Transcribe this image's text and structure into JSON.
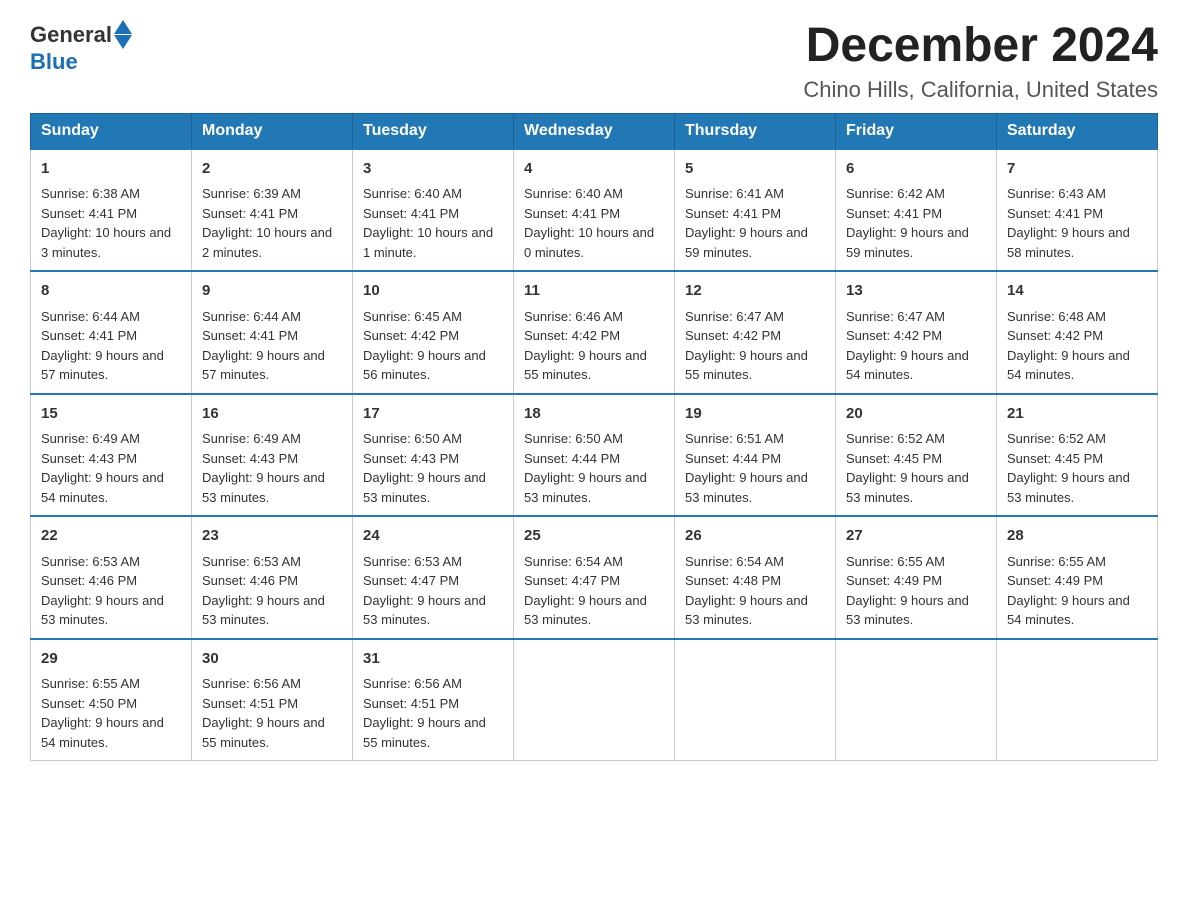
{
  "logo": {
    "general": "General",
    "blue": "Blue"
  },
  "title": "December 2024",
  "location": "Chino Hills, California, United States",
  "days_of_week": [
    "Sunday",
    "Monday",
    "Tuesday",
    "Wednesday",
    "Thursday",
    "Friday",
    "Saturday"
  ],
  "weeks": [
    [
      {
        "day": "1",
        "sunrise": "Sunrise: 6:38 AM",
        "sunset": "Sunset: 4:41 PM",
        "daylight": "Daylight: 10 hours and 3 minutes."
      },
      {
        "day": "2",
        "sunrise": "Sunrise: 6:39 AM",
        "sunset": "Sunset: 4:41 PM",
        "daylight": "Daylight: 10 hours and 2 minutes."
      },
      {
        "day": "3",
        "sunrise": "Sunrise: 6:40 AM",
        "sunset": "Sunset: 4:41 PM",
        "daylight": "Daylight: 10 hours and 1 minute."
      },
      {
        "day": "4",
        "sunrise": "Sunrise: 6:40 AM",
        "sunset": "Sunset: 4:41 PM",
        "daylight": "Daylight: 10 hours and 0 minutes."
      },
      {
        "day": "5",
        "sunrise": "Sunrise: 6:41 AM",
        "sunset": "Sunset: 4:41 PM",
        "daylight": "Daylight: 9 hours and 59 minutes."
      },
      {
        "day": "6",
        "sunrise": "Sunrise: 6:42 AM",
        "sunset": "Sunset: 4:41 PM",
        "daylight": "Daylight: 9 hours and 59 minutes."
      },
      {
        "day": "7",
        "sunrise": "Sunrise: 6:43 AM",
        "sunset": "Sunset: 4:41 PM",
        "daylight": "Daylight: 9 hours and 58 minutes."
      }
    ],
    [
      {
        "day": "8",
        "sunrise": "Sunrise: 6:44 AM",
        "sunset": "Sunset: 4:41 PM",
        "daylight": "Daylight: 9 hours and 57 minutes."
      },
      {
        "day": "9",
        "sunrise": "Sunrise: 6:44 AM",
        "sunset": "Sunset: 4:41 PM",
        "daylight": "Daylight: 9 hours and 57 minutes."
      },
      {
        "day": "10",
        "sunrise": "Sunrise: 6:45 AM",
        "sunset": "Sunset: 4:42 PM",
        "daylight": "Daylight: 9 hours and 56 minutes."
      },
      {
        "day": "11",
        "sunrise": "Sunrise: 6:46 AM",
        "sunset": "Sunset: 4:42 PM",
        "daylight": "Daylight: 9 hours and 55 minutes."
      },
      {
        "day": "12",
        "sunrise": "Sunrise: 6:47 AM",
        "sunset": "Sunset: 4:42 PM",
        "daylight": "Daylight: 9 hours and 55 minutes."
      },
      {
        "day": "13",
        "sunrise": "Sunrise: 6:47 AM",
        "sunset": "Sunset: 4:42 PM",
        "daylight": "Daylight: 9 hours and 54 minutes."
      },
      {
        "day": "14",
        "sunrise": "Sunrise: 6:48 AM",
        "sunset": "Sunset: 4:42 PM",
        "daylight": "Daylight: 9 hours and 54 minutes."
      }
    ],
    [
      {
        "day": "15",
        "sunrise": "Sunrise: 6:49 AM",
        "sunset": "Sunset: 4:43 PM",
        "daylight": "Daylight: 9 hours and 54 minutes."
      },
      {
        "day": "16",
        "sunrise": "Sunrise: 6:49 AM",
        "sunset": "Sunset: 4:43 PM",
        "daylight": "Daylight: 9 hours and 53 minutes."
      },
      {
        "day": "17",
        "sunrise": "Sunrise: 6:50 AM",
        "sunset": "Sunset: 4:43 PM",
        "daylight": "Daylight: 9 hours and 53 minutes."
      },
      {
        "day": "18",
        "sunrise": "Sunrise: 6:50 AM",
        "sunset": "Sunset: 4:44 PM",
        "daylight": "Daylight: 9 hours and 53 minutes."
      },
      {
        "day": "19",
        "sunrise": "Sunrise: 6:51 AM",
        "sunset": "Sunset: 4:44 PM",
        "daylight": "Daylight: 9 hours and 53 minutes."
      },
      {
        "day": "20",
        "sunrise": "Sunrise: 6:52 AM",
        "sunset": "Sunset: 4:45 PM",
        "daylight": "Daylight: 9 hours and 53 minutes."
      },
      {
        "day": "21",
        "sunrise": "Sunrise: 6:52 AM",
        "sunset": "Sunset: 4:45 PM",
        "daylight": "Daylight: 9 hours and 53 minutes."
      }
    ],
    [
      {
        "day": "22",
        "sunrise": "Sunrise: 6:53 AM",
        "sunset": "Sunset: 4:46 PM",
        "daylight": "Daylight: 9 hours and 53 minutes."
      },
      {
        "day": "23",
        "sunrise": "Sunrise: 6:53 AM",
        "sunset": "Sunset: 4:46 PM",
        "daylight": "Daylight: 9 hours and 53 minutes."
      },
      {
        "day": "24",
        "sunrise": "Sunrise: 6:53 AM",
        "sunset": "Sunset: 4:47 PM",
        "daylight": "Daylight: 9 hours and 53 minutes."
      },
      {
        "day": "25",
        "sunrise": "Sunrise: 6:54 AM",
        "sunset": "Sunset: 4:47 PM",
        "daylight": "Daylight: 9 hours and 53 minutes."
      },
      {
        "day": "26",
        "sunrise": "Sunrise: 6:54 AM",
        "sunset": "Sunset: 4:48 PM",
        "daylight": "Daylight: 9 hours and 53 minutes."
      },
      {
        "day": "27",
        "sunrise": "Sunrise: 6:55 AM",
        "sunset": "Sunset: 4:49 PM",
        "daylight": "Daylight: 9 hours and 53 minutes."
      },
      {
        "day": "28",
        "sunrise": "Sunrise: 6:55 AM",
        "sunset": "Sunset: 4:49 PM",
        "daylight": "Daylight: 9 hours and 54 minutes."
      }
    ],
    [
      {
        "day": "29",
        "sunrise": "Sunrise: 6:55 AM",
        "sunset": "Sunset: 4:50 PM",
        "daylight": "Daylight: 9 hours and 54 minutes."
      },
      {
        "day": "30",
        "sunrise": "Sunrise: 6:56 AM",
        "sunset": "Sunset: 4:51 PM",
        "daylight": "Daylight: 9 hours and 55 minutes."
      },
      {
        "day": "31",
        "sunrise": "Sunrise: 6:56 AM",
        "sunset": "Sunset: 4:51 PM",
        "daylight": "Daylight: 9 hours and 55 minutes."
      },
      null,
      null,
      null,
      null
    ]
  ]
}
